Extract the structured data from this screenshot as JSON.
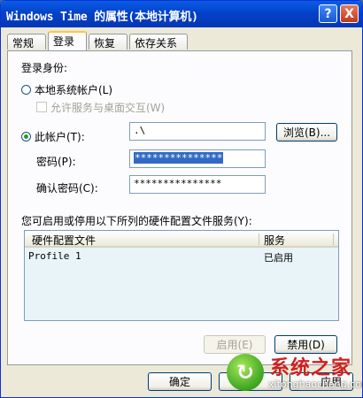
{
  "window": {
    "title": "Windows Time 的属性(本地计算机)",
    "help_label": "?",
    "close_label": "X"
  },
  "tabs": [
    {
      "label": "常规",
      "active": false
    },
    {
      "label": "登录",
      "active": true
    },
    {
      "label": "恢复",
      "active": false
    },
    {
      "label": "依存关系",
      "active": false
    }
  ],
  "logon": {
    "section_label": "登录身份:",
    "local_system": {
      "label": "本地系统帐户(L)",
      "selected": false
    },
    "allow_desktop": {
      "label": "允许服务与桌面交互(W)",
      "checked": false,
      "enabled": false
    },
    "this_account": {
      "label": "此帐户(T):",
      "selected": true,
      "value": ".\\",
      "browse_label": "浏览(B)..."
    },
    "password": {
      "label": "密码(P):",
      "value": "***************"
    },
    "confirm": {
      "label": "确认密码(C):",
      "value": "***************"
    }
  },
  "profiles": {
    "description": "您可启用或停用以下所列的硬件配置文件服务(Y):",
    "columns": [
      "硬件配置文件",
      "服务"
    ],
    "rows": [
      {
        "profile": "Profile 1",
        "service": "已启用"
      }
    ],
    "enable_label": "启用(E)",
    "disable_label": "禁用(D)"
  },
  "footer": {
    "ok_label": "确定",
    "apply_label": "应用"
  },
  "watermark": {
    "title": "系统之家",
    "url": "xitonghaochang.com"
  },
  "colors": {
    "titlebar": "#0442c9",
    "selection": "#316ac5",
    "radio_dot": "#21a121"
  }
}
